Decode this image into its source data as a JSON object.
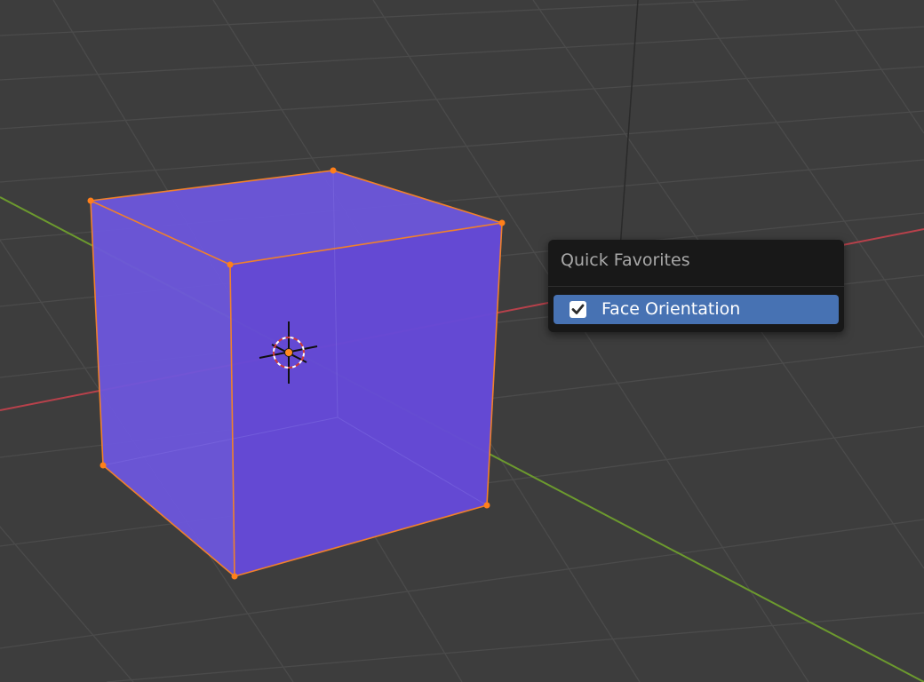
{
  "menu": {
    "title": "Quick Favorites",
    "items": [
      {
        "label": "Face Orientation",
        "checked": true,
        "highlighted": true
      }
    ]
  },
  "colors": {
    "background": "#3d3d3d",
    "grid_line": "#4b4b4b",
    "x_axis": "#b8414b",
    "y_axis": "#6c9a2e",
    "face_front": "#6549d8",
    "face_side": "#6d56dc",
    "edge_selected": "#f0802c",
    "vertex_selected": "#ff7f1a",
    "menu_background": "#181818",
    "menu_highlight": "#4772b3"
  },
  "icons": {
    "check": "checkmark-icon",
    "cursor": "3d-cursor-icon",
    "origin": "object-origin-icon"
  }
}
